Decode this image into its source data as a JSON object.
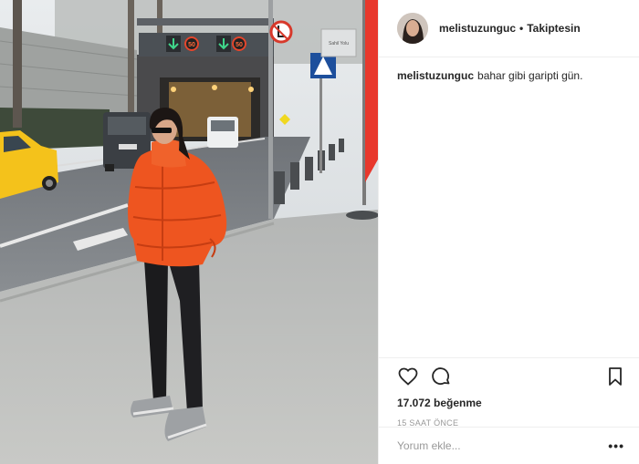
{
  "photo": {
    "signs": {
      "speed_limit_1": "50",
      "speed_limit_2": "50",
      "board_text": "Sahil Yolu"
    },
    "colors": {
      "jacket": "#ee5520",
      "taxi": "#f4c21b",
      "flag": "#e8382c"
    }
  },
  "header": {
    "username": "melistuzunguc",
    "separator": "•",
    "follow_status": "Takiptesin"
  },
  "caption": {
    "username": "melistuzunguc",
    "text": "bahar gibi garipti gün."
  },
  "actions": {
    "icons": [
      "heart-icon",
      "comment-icon",
      "bookmark-icon"
    ],
    "likes": "17.072 beğenme",
    "timestamp": "15 SAAT ÖNCE"
  },
  "comment": {
    "placeholder": "Yorum ekle...",
    "more": "•••"
  }
}
